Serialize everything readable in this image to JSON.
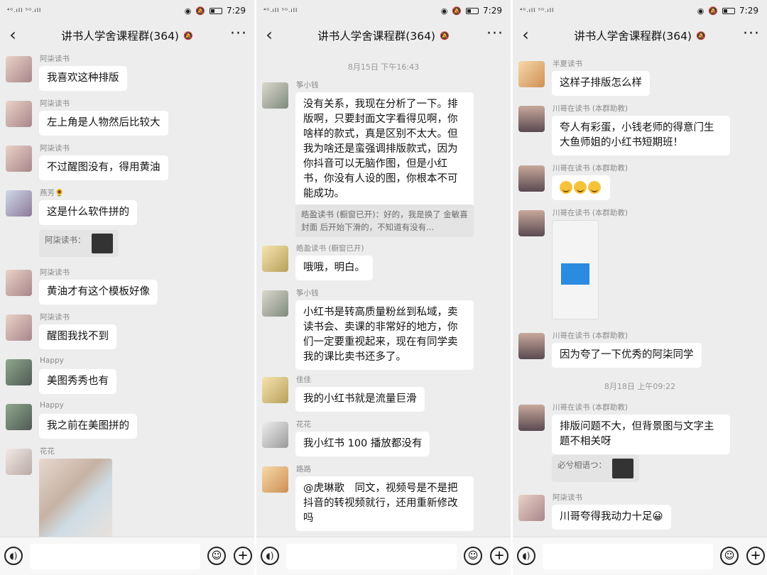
{
  "status": {
    "signal": "⁴ᴳ.ıll ⁵ᴳ.ıll",
    "time": "7:29"
  },
  "panels": [
    {
      "title": "讲书人学舍课程群(364)",
      "messages": [
        {
          "name": "阿柒读书",
          "text": "我喜欢这种排版"
        },
        {
          "name": "阿柒读书",
          "text": "左上角是人物然后比较大"
        },
        {
          "name": "阿柒读书",
          "text": "不过醒图没有，得用黄油"
        },
        {
          "name": "燕芳🌻",
          "text": "这是什么软件拼的",
          "quote": "阿柒读书："
        },
        {
          "name": "阿柒读书",
          "text": "黄油才有这个模板好像"
        },
        {
          "name": "阿柒读书",
          "text": "醒图我找不到"
        },
        {
          "name": "Happy",
          "text": "美图秀秀也有"
        },
        {
          "name": "Happy",
          "text": "我之前在美图拼的"
        },
        {
          "name": "花花"
        }
      ]
    },
    {
      "title": "讲书人学舍课程群(364)",
      "timestamp": "8月15日 下午16:43",
      "messages": [
        {
          "name": "筝小钱",
          "text": "没有关系，我现在分析了一下。排版啊，只要封面文字看得见啊，你啥样的款式，真是区别不太大。但我为啥还是蛮强调排版款式，因为你抖音可以无脑作图，但是小红书，你没有人设的图，你根本不可能成功。",
          "quote": "皓盈读书 (橱窗已开)：好的，我是换了 金敏喜封面 后开始下滑的，不知道有没有..."
        },
        {
          "name": "皓盈读书 (橱窗已开)",
          "text": "哦哦，明白。"
        },
        {
          "name": "筝小钱",
          "text": "小红书是转高质量粉丝到私域，卖读书会、卖课的非常好的地方，你们一定要重视起来，现在有同学卖我的课比卖书还多了。"
        },
        {
          "name": "佳佳",
          "text": "我的小红书就是流量巨滑"
        },
        {
          "name": "花花",
          "text": "我小红书 100 播放都没有"
        },
        {
          "name": "路路",
          "text": "@虎琳歌　同文，视频号是不是把抖音的转视频就行，还用重新修改吗"
        }
      ]
    },
    {
      "title": "讲书人学舍课程群(364)",
      "timestamp": "8月18日 上午09:22",
      "messages": [
        {
          "name": "半夏读书",
          "text": "这样子排版怎么样"
        },
        {
          "name": "川哥在读书 (本群助教)",
          "text": "夸人有彩蛋，小钱老师的得意门生大鱼师姐的小红书短期班！"
        },
        {
          "name": "川哥在读书 (本群助教)",
          "emoji_count": 3
        },
        {
          "name": "川哥在读书 (本群助教)"
        },
        {
          "name": "川哥在读书 (本群助教)",
          "text": "因为夸了一下优秀的阿柒同学"
        },
        {
          "name": "川哥在读书 (本群助教)",
          "text": "排版问题不大，但背景图与文字主题不相关呀",
          "quote": "必兮相语つ："
        },
        {
          "name": "阿柒读书",
          "text": "川哥夸得我动力十足😀"
        }
      ]
    }
  ]
}
